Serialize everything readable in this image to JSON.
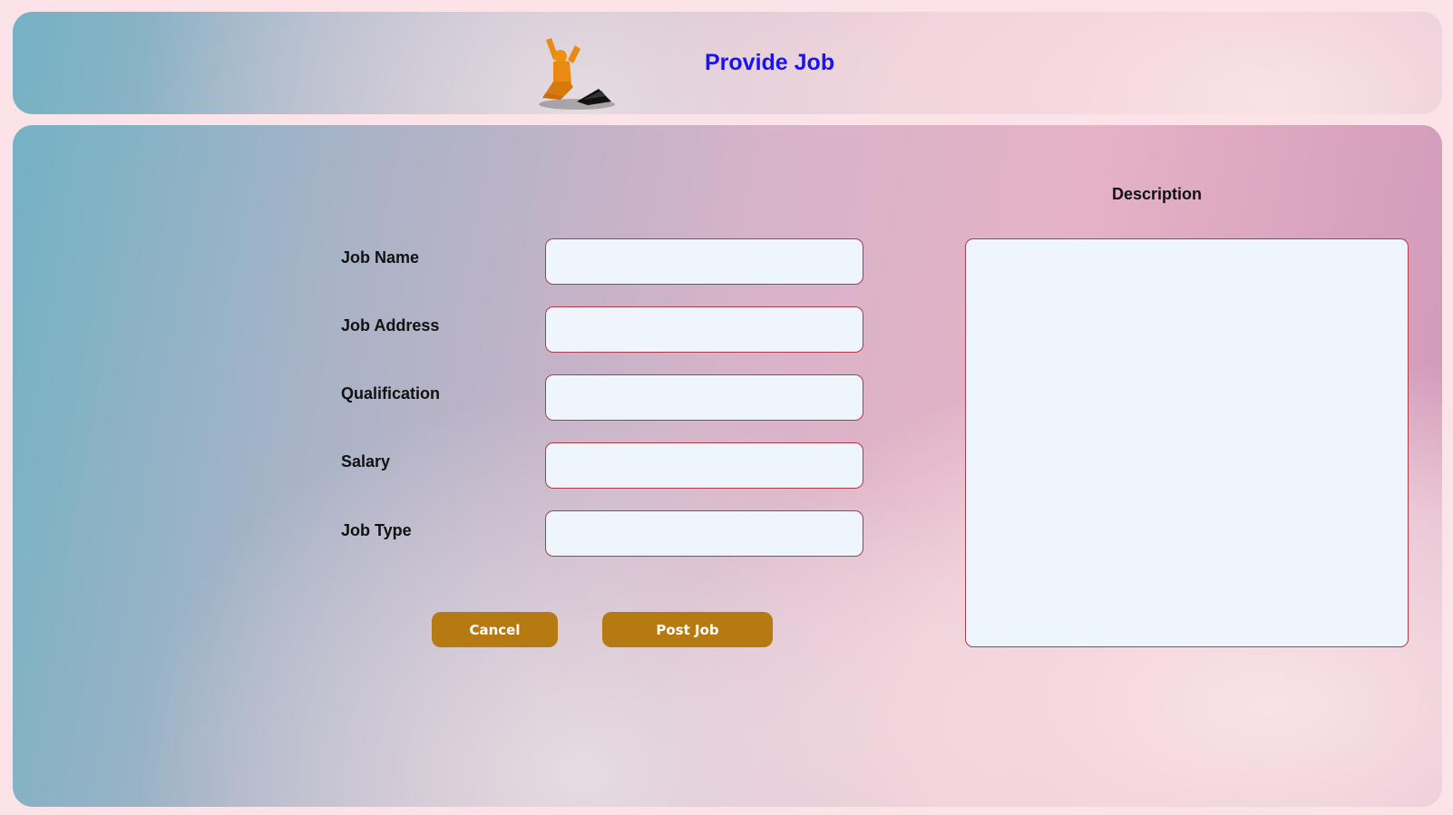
{
  "header": {
    "title": "Provide Job",
    "logo_icon": "person-celebrating-icon"
  },
  "form": {
    "fields": [
      {
        "label": "Job Name",
        "value": ""
      },
      {
        "label": "Job Address",
        "value": ""
      },
      {
        "label": "Qualification",
        "value": ""
      },
      {
        "label": "Salary",
        "value": ""
      },
      {
        "label": "Job Type",
        "value": ""
      }
    ],
    "description_label": "Description",
    "description_value": "",
    "cancel_label": "Cancel",
    "post_label": "Post Job"
  },
  "colors": {
    "title": "#1a13f0",
    "button": "#b57a12",
    "input_border": "#b03a48",
    "input_bg": "#eff5fd"
  }
}
